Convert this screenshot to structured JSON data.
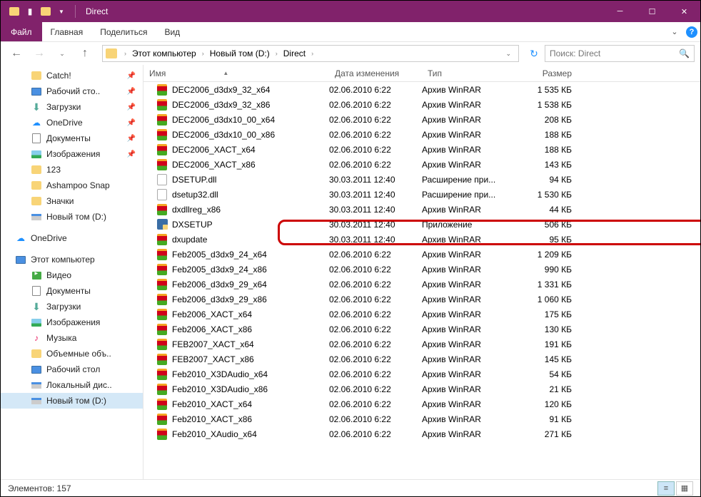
{
  "window": {
    "title": "Direct"
  },
  "ribbon": {
    "file": "Файл",
    "tabs": [
      "Главная",
      "Поделиться",
      "Вид"
    ]
  },
  "breadcrumb": {
    "items": [
      "Этот компьютер",
      "Новый том (D:)",
      "Direct"
    ]
  },
  "search": {
    "placeholder": "Поиск: Direct"
  },
  "columns": {
    "name": "Имя",
    "date": "Дата изменения",
    "type": "Тип",
    "size": "Размер"
  },
  "sidebar": {
    "quick": [
      {
        "label": "Catch!",
        "icon": "folder",
        "pinned": true
      },
      {
        "label": "Рабочий сто..",
        "icon": "monitor",
        "pinned": true
      },
      {
        "label": "Загрузки",
        "icon": "down",
        "pinned": true
      },
      {
        "label": "OneDrive",
        "icon": "cloud",
        "pinned": true
      },
      {
        "label": "Документы",
        "icon": "doc",
        "pinned": true
      },
      {
        "label": "Изображения",
        "icon": "img",
        "pinned": true
      },
      {
        "label": "123",
        "icon": "folder",
        "pinned": false
      },
      {
        "label": "Ashampoo Snap",
        "icon": "folder",
        "pinned": false
      },
      {
        "label": "Значки",
        "icon": "folder",
        "pinned": false
      },
      {
        "label": "Новый том (D:)",
        "icon": "disk",
        "pinned": false
      }
    ],
    "onedrive": {
      "label": "OneDrive",
      "icon": "cloud"
    },
    "thispc": {
      "label": "Этот компьютер",
      "children": [
        {
          "label": "Видео",
          "icon": "video"
        },
        {
          "label": "Документы",
          "icon": "doc"
        },
        {
          "label": "Загрузки",
          "icon": "down"
        },
        {
          "label": "Изображения",
          "icon": "img"
        },
        {
          "label": "Музыка",
          "icon": "music"
        },
        {
          "label": "Объемные объ..",
          "icon": "folder"
        },
        {
          "label": "Рабочий стол",
          "icon": "monitor"
        },
        {
          "label": "Локальный дис..",
          "icon": "disk"
        },
        {
          "label": "Новый том (D:)",
          "icon": "disk",
          "selected": true
        }
      ]
    }
  },
  "files": [
    {
      "name": "DEC2006_d3dx9_32_x64",
      "date": "02.06.2010 6:22",
      "type": "Архив WinRAR",
      "size": "1 535 КБ",
      "icon": "rar"
    },
    {
      "name": "DEC2006_d3dx9_32_x86",
      "date": "02.06.2010 6:22",
      "type": "Архив WinRAR",
      "size": "1 538 КБ",
      "icon": "rar"
    },
    {
      "name": "DEC2006_d3dx10_00_x64",
      "date": "02.06.2010 6:22",
      "type": "Архив WinRAR",
      "size": "208 КБ",
      "icon": "rar"
    },
    {
      "name": "DEC2006_d3dx10_00_x86",
      "date": "02.06.2010 6:22",
      "type": "Архив WinRAR",
      "size": "188 КБ",
      "icon": "rar"
    },
    {
      "name": "DEC2006_XACT_x64",
      "date": "02.06.2010 6:22",
      "type": "Архив WinRAR",
      "size": "188 КБ",
      "icon": "rar"
    },
    {
      "name": "DEC2006_XACT_x86",
      "date": "02.06.2010 6:22",
      "type": "Архив WinRAR",
      "size": "143 КБ",
      "icon": "rar"
    },
    {
      "name": "DSETUP.dll",
      "date": "30.03.2011 12:40",
      "type": "Расширение при...",
      "size": "94 КБ",
      "icon": "dll"
    },
    {
      "name": "dsetup32.dll",
      "date": "30.03.2011 12:40",
      "type": "Расширение при...",
      "size": "1 530 КБ",
      "icon": "dll"
    },
    {
      "name": "dxdllreg_x86",
      "date": "30.03.2011 12:40",
      "type": "Архив WinRAR",
      "size": "44 КБ",
      "icon": "rar"
    },
    {
      "name": "DXSETUP",
      "date": "30.03.2011 12:40",
      "type": "Приложение",
      "size": "506 КБ",
      "icon": "exe"
    },
    {
      "name": "dxupdate",
      "date": "30.03.2011 12:40",
      "type": "Архив WinRAR",
      "size": "95 КБ",
      "icon": "rar"
    },
    {
      "name": "Feb2005_d3dx9_24_x64",
      "date": "02.06.2010 6:22",
      "type": "Архив WinRAR",
      "size": "1 209 КБ",
      "icon": "rar"
    },
    {
      "name": "Feb2005_d3dx9_24_x86",
      "date": "02.06.2010 6:22",
      "type": "Архив WinRAR",
      "size": "990 КБ",
      "icon": "rar"
    },
    {
      "name": "Feb2006_d3dx9_29_x64",
      "date": "02.06.2010 6:22",
      "type": "Архив WinRAR",
      "size": "1 331 КБ",
      "icon": "rar"
    },
    {
      "name": "Feb2006_d3dx9_29_x86",
      "date": "02.06.2010 6:22",
      "type": "Архив WinRAR",
      "size": "1 060 КБ",
      "icon": "rar"
    },
    {
      "name": "Feb2006_XACT_x64",
      "date": "02.06.2010 6:22",
      "type": "Архив WinRAR",
      "size": "175 КБ",
      "icon": "rar"
    },
    {
      "name": "Feb2006_XACT_x86",
      "date": "02.06.2010 6:22",
      "type": "Архив WinRAR",
      "size": "130 КБ",
      "icon": "rar"
    },
    {
      "name": "FEB2007_XACT_x64",
      "date": "02.06.2010 6:22",
      "type": "Архив WinRAR",
      "size": "191 КБ",
      "icon": "rar"
    },
    {
      "name": "FEB2007_XACT_x86",
      "date": "02.06.2010 6:22",
      "type": "Архив WinRAR",
      "size": "145 КБ",
      "icon": "rar"
    },
    {
      "name": "Feb2010_X3DAudio_x64",
      "date": "02.06.2010 6:22",
      "type": "Архив WinRAR",
      "size": "54 КБ",
      "icon": "rar"
    },
    {
      "name": "Feb2010_X3DAudio_x86",
      "date": "02.06.2010 6:22",
      "type": "Архив WinRAR",
      "size": "21 КБ",
      "icon": "rar"
    },
    {
      "name": "Feb2010_XACT_x64",
      "date": "02.06.2010 6:22",
      "type": "Архив WinRAR",
      "size": "120 КБ",
      "icon": "rar"
    },
    {
      "name": "Feb2010_XACT_x86",
      "date": "02.06.2010 6:22",
      "type": "Архив WinRAR",
      "size": "91 КБ",
      "icon": "rar"
    },
    {
      "name": "Feb2010_XAudio_x64",
      "date": "02.06.2010 6:22",
      "type": "Архив WinRAR",
      "size": "271 КБ",
      "icon": "rar"
    }
  ],
  "status": {
    "items_label": "Элементов:",
    "items_count": "157"
  }
}
